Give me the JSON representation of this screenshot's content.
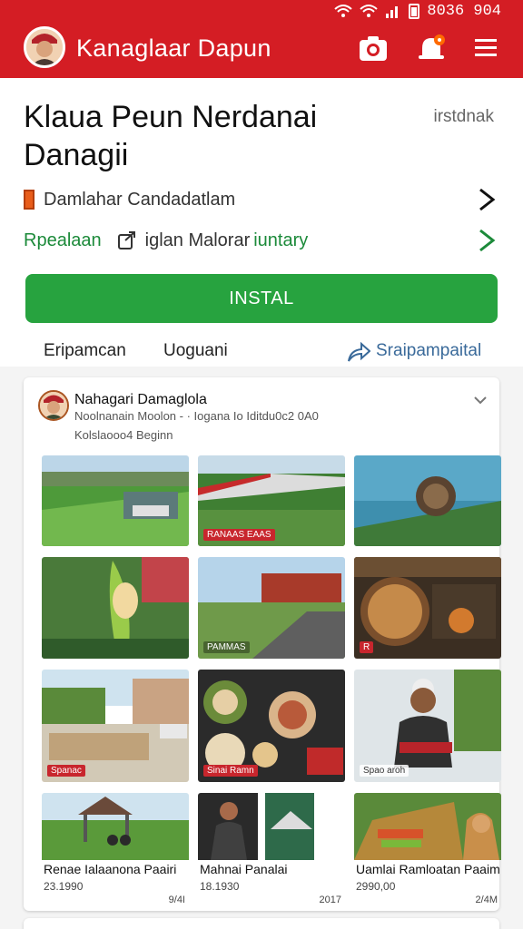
{
  "status_bar": {
    "time": "8036 904"
  },
  "header": {
    "title": "Kanaglaar Dapun"
  },
  "app": {
    "title": "Klaua Peun Nerdanai Danagii",
    "side_label": "irstdnak",
    "row1_label": "Damlahar Candadatlam",
    "row2_label_a": "Rpealaan",
    "row2_label_b": "iglan Malorar",
    "row2_label_c": "iuntary",
    "install_label": "INSTAL"
  },
  "tabs": [
    {
      "label": "Eripamcan"
    },
    {
      "label": "Uoguani"
    },
    {
      "label": "Sraipampaital"
    }
  ],
  "post": {
    "name": "Nahagari Damaglola",
    "meta": "Noolnanain Moolon - · Iogana Io Iditdu0c2 0A0",
    "sub": "Kolslaooo4 Beginn"
  },
  "tiles": [
    {
      "overlay": ""
    },
    {
      "overlay": "RANAAS EAAS"
    },
    {
      "overlay": ""
    },
    {
      "overlay": ""
    },
    {
      "overlay": "PAMMAS"
    },
    {
      "overlay": "R"
    },
    {
      "overlay": "Spanac"
    },
    {
      "overlay": "Sinai Ramn"
    },
    {
      "overlay": "Spao aroh"
    },
    {
      "overlay": "",
      "caption": "Renae Ialaanona Paairi",
      "num": "23.1990",
      "num2": "9/4I"
    },
    {
      "overlay": "",
      "caption": "Mahnai Panalai",
      "num": "18.1930",
      "num2": "2017"
    },
    {
      "overlay": "",
      "caption": "Uamlai Ramloatan Paaim",
      "num": "2990,00",
      "num2": "2/4M"
    }
  ],
  "colors": {
    "brand_red": "#d41d24",
    "install_green": "#27a33f",
    "link_blue": "#3a6a9a"
  },
  "icons": [
    "wifi-icon",
    "signal-icon",
    "battery-icon",
    "camera-icon",
    "notification-icon",
    "menu-icon",
    "chevron-right-icon",
    "share-icon",
    "chevron-down-icon"
  ]
}
